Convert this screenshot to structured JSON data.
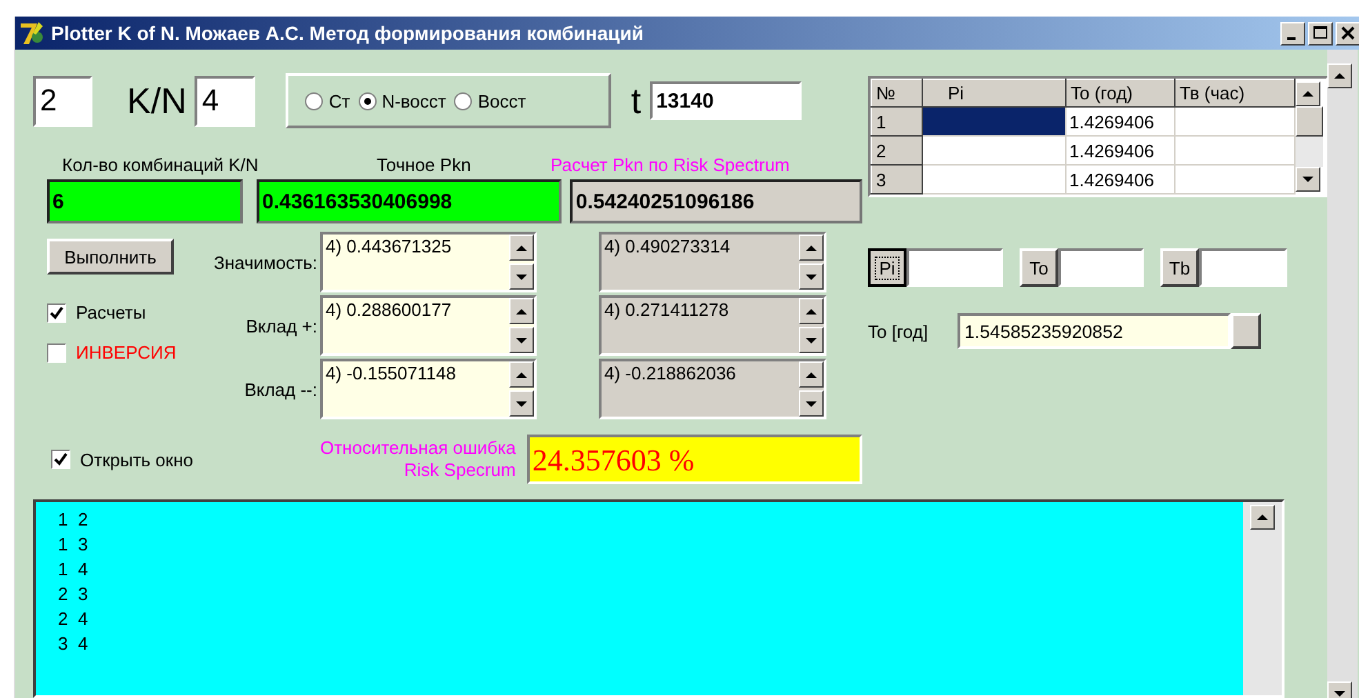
{
  "window": {
    "title": "Plotter  K of N. Можаев А.С. Метод формирования комбинаций"
  },
  "k_field": {
    "value": "2"
  },
  "kn_label": "K/N",
  "n_field": {
    "value": "4"
  },
  "modes": [
    {
      "label": "Ст",
      "selected": false
    },
    {
      "label": "N-восст",
      "selected": true
    },
    {
      "label": "Восст",
      "selected": false
    }
  ],
  "t_label": "t",
  "t_field": {
    "value": "13140"
  },
  "results": [
    {
      "label": "Кол-во комбинаций K/N",
      "value": "6",
      "kind": "exact"
    },
    {
      "label": "Точное Pkn",
      "value": "0.436163530406998",
      "kind": "exact"
    },
    {
      "label": "Расчет Pkn  по Risk Spectrum",
      "value": "0.54240251096186",
      "kind": "risk"
    }
  ],
  "run_button": "Выполнить",
  "options": [
    {
      "label": "Расчеты",
      "checked": true,
      "color": "#000000"
    },
    {
      "label": "ИНВЕРСИЯ",
      "checked": false,
      "color": "#ff0000"
    }
  ],
  "measures": [
    {
      "label": "Значимость:",
      "exact": "4) 0.443671325",
      "risk": "4) 0.490273314"
    },
    {
      "label": "Вклад +:",
      "exact": "4) 0.288600177",
      "risk": "4) 0.271411278"
    },
    {
      "label": "Вклад --:",
      "exact": "4) -0.155071148",
      "risk": "4) -0.218862036"
    }
  ],
  "open_window": {
    "label": "Открыть окно",
    "checked": true
  },
  "error": {
    "label_lines": [
      "Относительная ошибка",
      "Risk Specrum"
    ],
    "value": "24.357603 %"
  },
  "table": {
    "columns": [
      "№",
      "Pi",
      "To (год)",
      "Тв (час)"
    ],
    "rows": [
      {
        "num": "1",
        "pi": "",
        "to": "1.4269406",
        "tv": "",
        "selected": true
      },
      {
        "num": "2",
        "pi": "",
        "to": "1.4269406",
        "tv": "",
        "selected": false
      },
      {
        "num": "3",
        "pi": "",
        "to": "1.4269406",
        "tv": "",
        "selected": false
      }
    ]
  },
  "editors": [
    {
      "button": "Pi",
      "focused": true
    },
    {
      "button": "To",
      "focused": false
    },
    {
      "button": "Tb",
      "focused": false
    }
  ],
  "to_year": {
    "label": "To [год]",
    "value": "1.54585235920852"
  },
  "combinations": [
    "1  2",
    "1  3",
    "1  4",
    "2  3",
    "2  4",
    "3  4"
  ]
}
